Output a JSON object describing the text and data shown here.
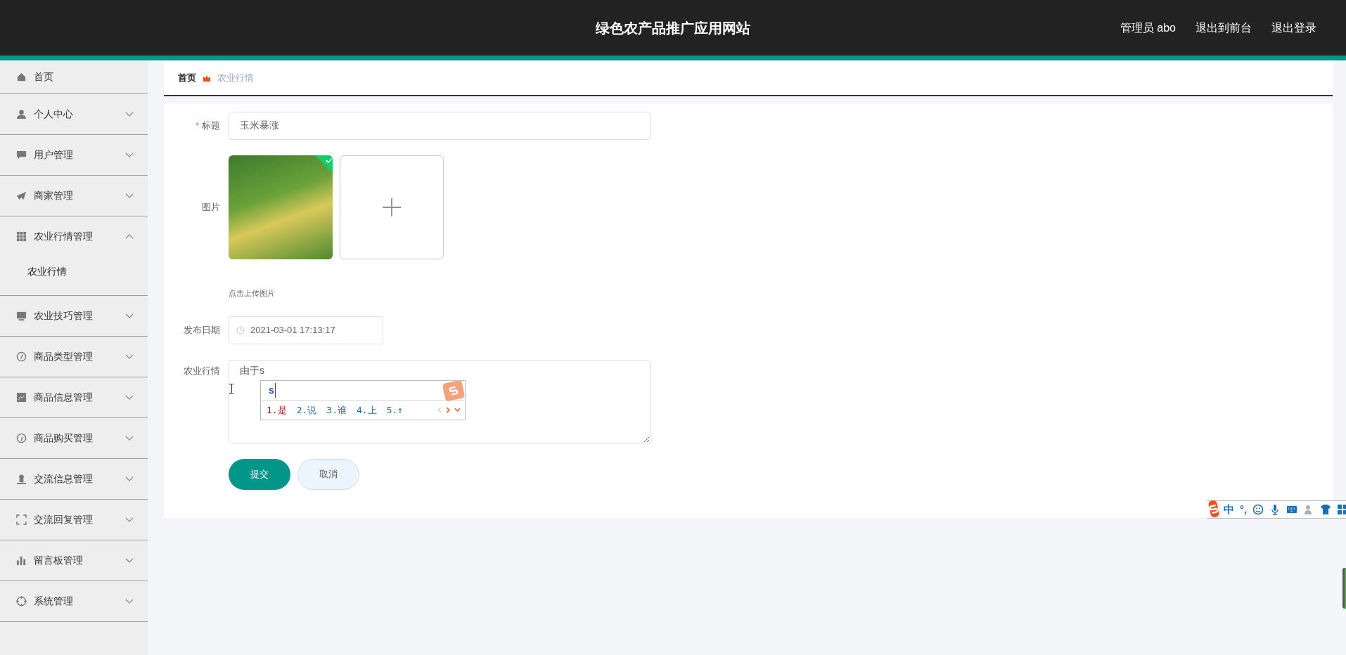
{
  "header": {
    "title": "绿色农产品推广应用网站",
    "links": [
      "管理员 abo",
      "退出到前台",
      "退出登录"
    ]
  },
  "sidebar": {
    "items": [
      {
        "label": "首页"
      },
      {
        "label": "个人中心",
        "expanded": false
      },
      {
        "label": "用户管理",
        "expanded": false
      },
      {
        "label": "商家管理",
        "expanded": false
      },
      {
        "label": "农业行情管理",
        "expanded": true,
        "children": [
          {
            "label": "农业行情"
          }
        ]
      },
      {
        "label": "农业技巧管理",
        "expanded": false
      },
      {
        "label": "商品类型管理",
        "expanded": false
      },
      {
        "label": "商品信息管理",
        "expanded": false
      },
      {
        "label": "商品购买管理",
        "expanded": false
      },
      {
        "label": "交流信息管理",
        "expanded": false
      },
      {
        "label": "交流回复管理",
        "expanded": false
      },
      {
        "label": "留言板管理",
        "expanded": false
      },
      {
        "label": "系统管理",
        "expanded": false
      }
    ]
  },
  "breadcrumb": [
    "首页",
    "农业行情"
  ],
  "form": {
    "title": {
      "label": "标题",
      "required_mark": "*",
      "value": "玉米暴涨"
    },
    "image": {
      "label": "图片",
      "hint": "点击上传图片"
    },
    "date": {
      "label": "发布日期",
      "value": "2021-03-01 17:13:17"
    },
    "content": {
      "label": "农业行情",
      "value": "由于s"
    },
    "buttons": [
      "提交",
      "取消"
    ]
  },
  "ime": {
    "input": "s",
    "candidates": [
      {
        "text": "1.是",
        "selected": true
      },
      {
        "text": "2.说",
        "selected": false
      },
      {
        "text": "3.谁",
        "selected": false
      },
      {
        "text": "4.上",
        "selected": false
      },
      {
        "text": "5.↑",
        "selected": false
      }
    ],
    "toolbar": [
      "中",
      "°,"
    ]
  }
}
